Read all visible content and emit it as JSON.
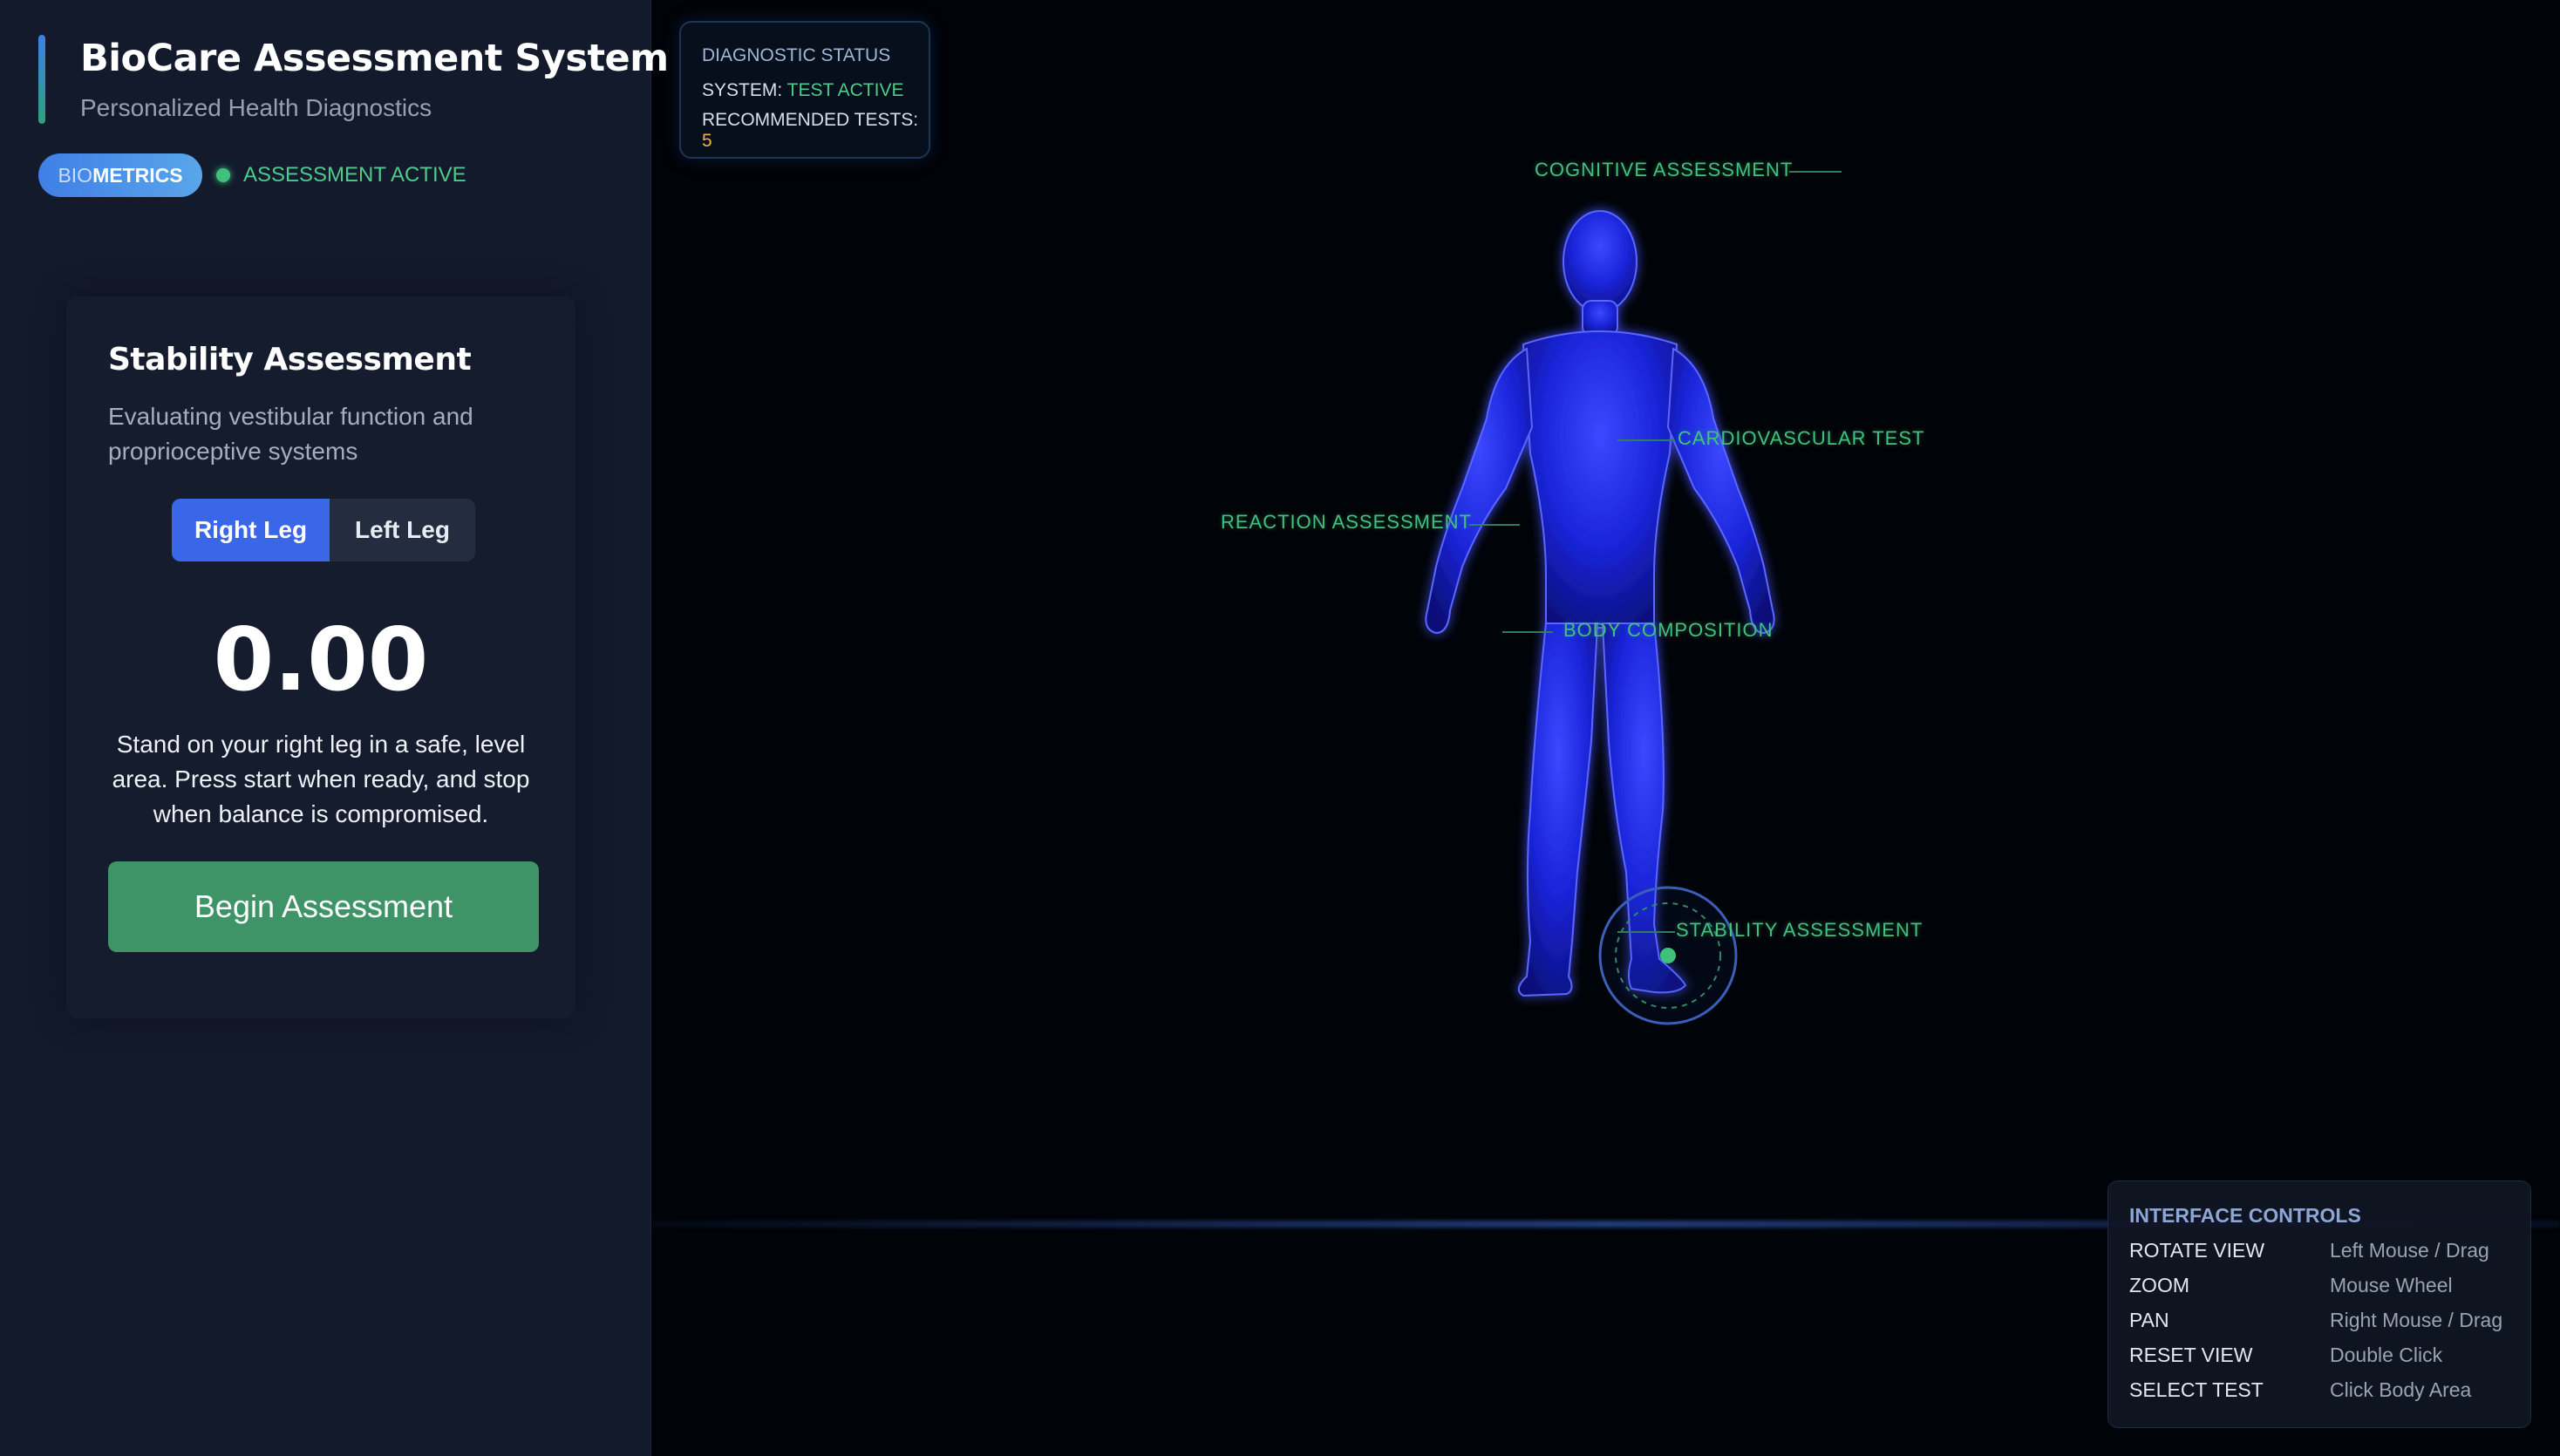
{
  "sidebar": {
    "title": "BioCare Assessment System",
    "subtitle": "Personalized Health Diagnostics",
    "badge_prefix": "BIO",
    "badge_main": "METRICS",
    "status": "ASSESSMENT ACTIVE",
    "card": {
      "title": "Stability Assessment",
      "description": "Evaluating vestibular function and proprioceptive systems",
      "leg_options": [
        "Right Leg",
        "Left Leg"
      ],
      "selected_leg": "Right Leg",
      "timer": "0.00",
      "instructions": "Stand on your right leg in a safe, level area. Press start when ready, and stop when balance is compromised.",
      "begin_label": "Begin Assessment"
    }
  },
  "diagnostic": {
    "header": "DIAGNOSTIC STATUS",
    "system_label": "SYSTEM:",
    "system_value": "TEST ACTIVE",
    "tests_label": "RECOMMENDED TESTS:",
    "tests_value": "5"
  },
  "annotations": {
    "cognitive": "COGNITIVE ASSESSMENT",
    "cardio": "CARDIOVASCULAR TEST",
    "reaction": "REACTION ASSESSMENT",
    "body": "BODY COMPOSITION",
    "stability": "STABILITY ASSESSMENT"
  },
  "controls": {
    "title": "INTERFACE CONTROLS",
    "rows": [
      {
        "action": "ROTATE VIEW",
        "input": "Left Mouse / Drag"
      },
      {
        "action": "ZOOM",
        "input": "Mouse Wheel"
      },
      {
        "action": "PAN",
        "input": "Right Mouse / Drag"
      },
      {
        "action": "RESET VIEW",
        "input": "Double Click"
      },
      {
        "action": "SELECT TEST",
        "input": "Click Body Area"
      }
    ]
  },
  "colors": {
    "accent_blue": "#3a66e8",
    "accent_green": "#3e9466",
    "annotation_green": "#44c07e",
    "figure_blue": "#1c2cff"
  }
}
